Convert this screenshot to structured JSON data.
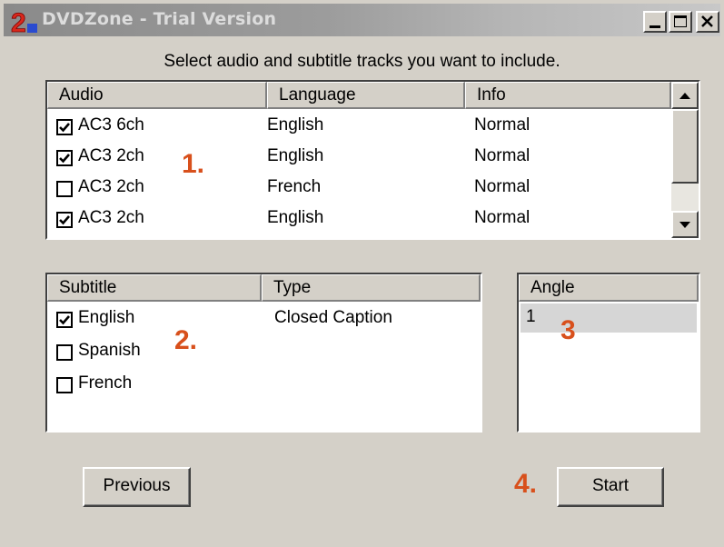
{
  "window": {
    "title": "DVDZone - Trial Version",
    "logo_text": "2"
  },
  "instruction": "Select audio and subtitle tracks you want to include.",
  "audio": {
    "headers": [
      "Audio",
      "Language",
      "Info"
    ],
    "rows": [
      {
        "checked": true,
        "audio": "AC3 6ch",
        "language": "English",
        "info": "Normal"
      },
      {
        "checked": true,
        "audio": "AC3 2ch",
        "language": "English",
        "info": "Normal"
      },
      {
        "checked": false,
        "audio": "AC3 2ch",
        "language": "French",
        "info": "Normal"
      },
      {
        "checked": true,
        "audio": "AC3 2ch",
        "language": "English",
        "info": "Normal"
      }
    ]
  },
  "subtitle": {
    "headers": [
      "Subtitle",
      "Type"
    ],
    "rows": [
      {
        "checked": true,
        "subtitle": "English",
        "type": "Closed Caption"
      },
      {
        "checked": false,
        "subtitle": "Spanish",
        "type": ""
      },
      {
        "checked": false,
        "subtitle": "French",
        "type": ""
      }
    ]
  },
  "angle": {
    "header": "Angle",
    "items": [
      "1"
    ]
  },
  "markers": {
    "m1": "1.",
    "m2": "2.",
    "m3": "3",
    "m4": "4."
  },
  "buttons": {
    "previous": "Previous",
    "start": "Start"
  },
  "colors": {
    "marker": "#d8501c",
    "face": "#d4d0c8"
  }
}
